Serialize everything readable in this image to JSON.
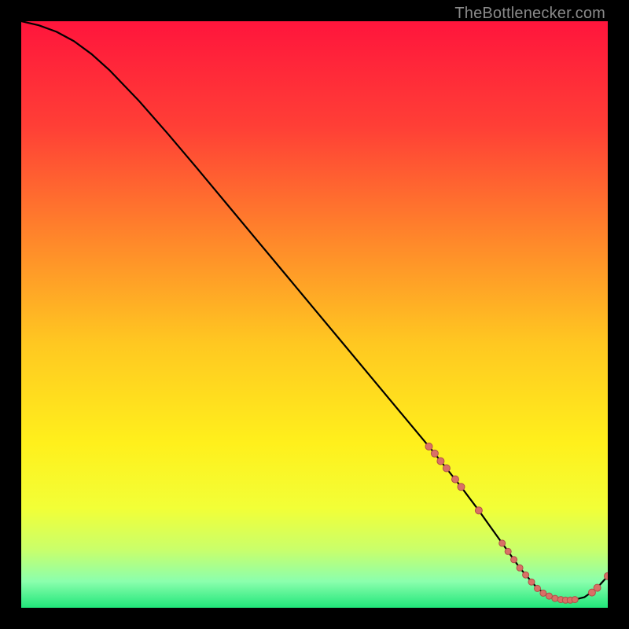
{
  "watermark": "TheBottlenecker.com",
  "colors": {
    "curve": "#000000",
    "dot_fill": "#d97066",
    "dot_stroke": "#b05048"
  },
  "chart_data": {
    "type": "line",
    "title": "",
    "xlabel": "",
    "ylabel": "",
    "xlim": [
      0,
      100
    ],
    "ylim": [
      0,
      100
    ],
    "series": [
      {
        "name": "bottleneck-curve",
        "x": [
          0,
          3,
          6,
          9,
          12,
          15,
          20,
          25,
          30,
          35,
          40,
          45,
          50,
          55,
          60,
          65,
          70,
          72,
          75,
          78,
          80,
          82,
          85,
          88,
          90,
          92,
          94,
          96,
          98,
          100
        ],
        "y": [
          100,
          99.3,
          98.2,
          96.6,
          94.4,
          91.7,
          86.5,
          80.8,
          74.9,
          68.9,
          62.9,
          56.9,
          50.9,
          44.9,
          38.9,
          32.9,
          26.9,
          24.4,
          20.6,
          16.6,
          13.8,
          11.0,
          6.8,
          3.3,
          2.0,
          1.4,
          1.3,
          1.8,
          3.2,
          5.4
        ]
      }
    ],
    "dot_clusters": [
      {
        "name": "descent",
        "points": [
          {
            "x": 69.5,
            "y": 27.5
          },
          {
            "x": 70.5,
            "y": 26.3
          },
          {
            "x": 71.5,
            "y": 25.0
          },
          {
            "x": 72.5,
            "y": 23.8
          },
          {
            "x": 74.0,
            "y": 21.9
          },
          {
            "x": 75.0,
            "y": 20.6
          },
          {
            "x": 78.0,
            "y": 16.6
          }
        ],
        "radius": 4.5
      },
      {
        "name": "valley",
        "points": [
          {
            "x": 82.0,
            "y": 11.0
          },
          {
            "x": 83.0,
            "y": 9.6
          },
          {
            "x": 84.0,
            "y": 8.2
          },
          {
            "x": 85.0,
            "y": 6.8
          },
          {
            "x": 86.0,
            "y": 5.6
          },
          {
            "x": 87.0,
            "y": 4.4
          },
          {
            "x": 88.0,
            "y": 3.3
          },
          {
            "x": 89.0,
            "y": 2.5
          },
          {
            "x": 90.0,
            "y": 2.0
          },
          {
            "x": 91.0,
            "y": 1.6
          },
          {
            "x": 92.0,
            "y": 1.4
          },
          {
            "x": 92.8,
            "y": 1.3
          },
          {
            "x": 93.6,
            "y": 1.3
          },
          {
            "x": 94.4,
            "y": 1.4
          }
        ],
        "radius": 4.0
      },
      {
        "name": "rise",
        "points": [
          {
            "x": 97.3,
            "y": 2.6
          },
          {
            "x": 98.2,
            "y": 3.4
          },
          {
            "x": 100.0,
            "y": 5.4
          }
        ],
        "radius": 4.5
      }
    ]
  }
}
